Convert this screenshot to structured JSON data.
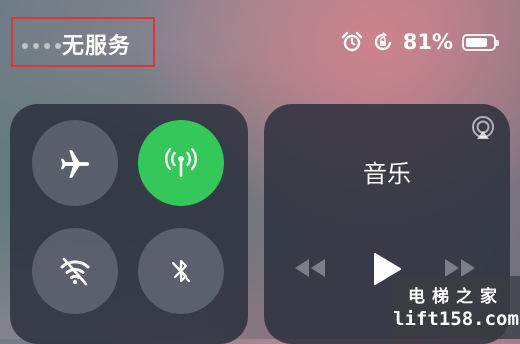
{
  "status_bar": {
    "carrier": "无服务",
    "battery_percent_text": "81%",
    "battery_level": 0.81,
    "icons": [
      "alarm-icon",
      "rotation-lock-icon",
      "battery-icon"
    ],
    "highlight_color": "#d83a32"
  },
  "connectivity": {
    "airplane_mode": {
      "icon": "airplane-icon",
      "active": false
    },
    "cellular_data": {
      "icon": "cellular-antenna-icon",
      "active": true,
      "color": "#34c759"
    },
    "wifi": {
      "icon": "wifi-off-icon",
      "active": false
    },
    "bluetooth": {
      "icon": "bluetooth-off-icon",
      "active": false
    }
  },
  "music": {
    "title": "音乐",
    "icons": [
      "airplay-icon",
      "rewind-icon",
      "play-icon",
      "fast-forward-icon"
    ]
  },
  "watermark": {
    "line1": "电梯之家",
    "line2": "lift158.com"
  }
}
